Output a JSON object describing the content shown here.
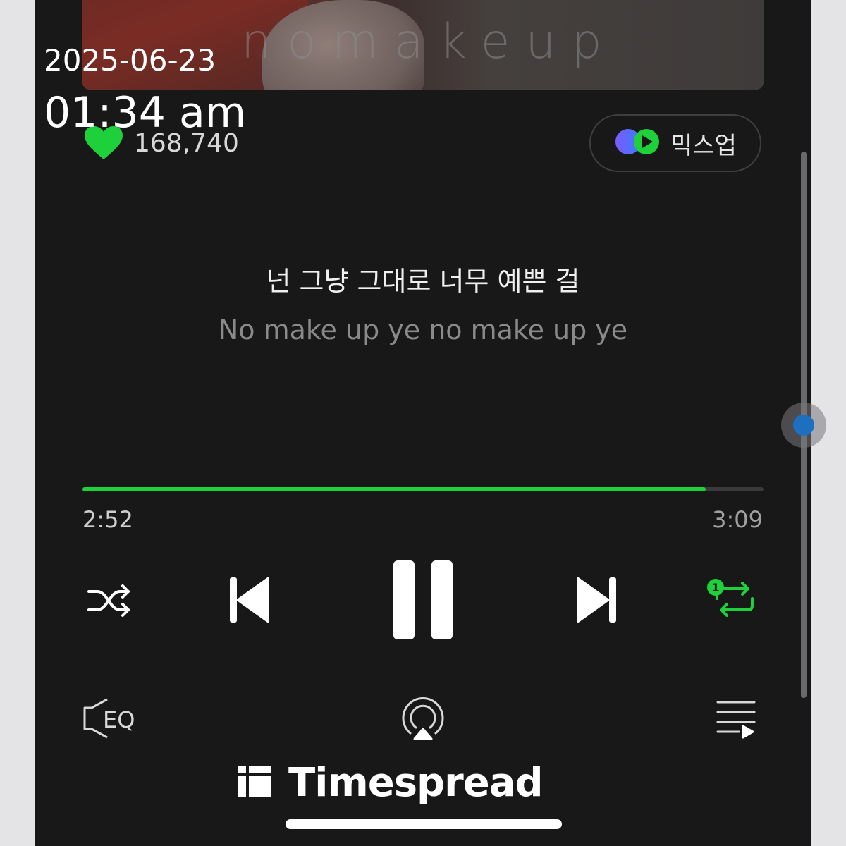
{
  "overlay": {
    "date": "2025-06-23",
    "time": "01:34 am"
  },
  "album": {
    "title_art": "nomakeup"
  },
  "like": {
    "count": "168,740",
    "icon": "heart-icon",
    "color": "#1ed03a"
  },
  "mixup": {
    "label": "믹스업",
    "icon": "mixup-icon"
  },
  "lyrics": {
    "current": "넌 그냥 그대로 너무 예쁜 걸",
    "next": "No make up ye no make up ye"
  },
  "playback": {
    "elapsed": "2:52",
    "duration": "3:09",
    "progress_fraction": 0.915,
    "accent_color": "#1ed03a"
  },
  "controls": {
    "shuffle": "shuffle-icon",
    "previous": "previous-icon",
    "pause": "pause-icon",
    "next": "next-icon",
    "repeat": "repeat-one-icon",
    "repeat_badge": "1"
  },
  "bottom_bar": {
    "eq_label": "EQ",
    "airplay": "airplay-icon",
    "queue": "playlist-icon"
  },
  "branding": {
    "name": "Timespread"
  }
}
